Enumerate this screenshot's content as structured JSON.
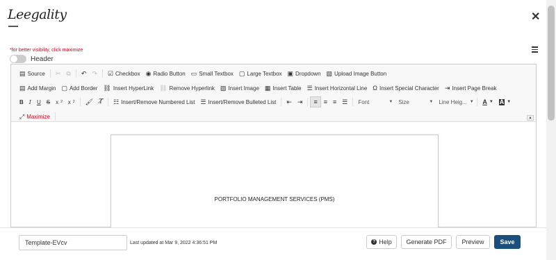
{
  "app": {
    "logo_text": "Leegality",
    "close_icon": "close-icon"
  },
  "header_controls": {
    "visibility_hint": "*for better visibility, click maximize",
    "header_toggle_label": "Header",
    "header_toggle_on": false
  },
  "toolbar": {
    "row1": {
      "source": "Source",
      "checkbox": "Checkbox",
      "radio_button": "Radio Button",
      "small_textbox": "Small Textbox",
      "large_textbox": "Large Textbox",
      "dropdown": "Dropdown",
      "upload_image_button": "Upload Image Button"
    },
    "row2": {
      "add_margin": "Add Margin",
      "add_border": "Add Border",
      "insert_hyperlink": "Insert HyperLink",
      "remove_hyperlink": "Remove Hyperlink",
      "insert_image": "Insert Image",
      "insert_table": "Insert Table",
      "insert_horizontal_line": "Insert Horizontal Line",
      "insert_special_character": "Insert Special Character",
      "insert_page_break": "Insert Page Break"
    },
    "row3": {
      "bold": "B",
      "italic": "I",
      "underline": "U",
      "strike": "S",
      "subscript": "x",
      "superscript": "x",
      "numbered_list": "Insert/Remove Numbered List",
      "bulleted_list": "Insert/Remove Bulleted List",
      "font": "Font",
      "size": "Size",
      "line_height": "Line Heig..."
    },
    "row4": {
      "maximize": "Maximize"
    }
  },
  "document": {
    "body_text": "PORTFOLIO MANAGEMENT SERVICES (PMS)"
  },
  "footer": {
    "template_name": "Template-EVcv",
    "last_updated": "Last updated at Mar 9, 2022 4:36:51 PM",
    "help": "Help",
    "generate_pdf": "Generate PDF",
    "preview": "Preview",
    "save": "Save"
  },
  "colors": {
    "accent": "#1d4f7c",
    "hint_red": "#d0021b"
  }
}
